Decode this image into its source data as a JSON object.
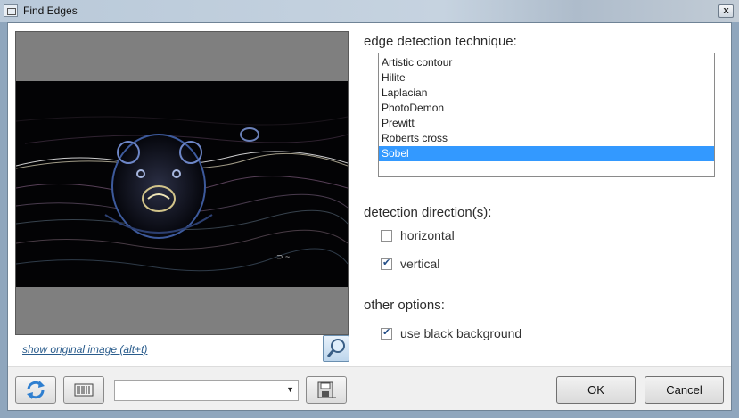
{
  "window": {
    "title": "Find Edges",
    "close_label": "x"
  },
  "preview": {
    "show_original_link": "show original image (alt+t)"
  },
  "technique": {
    "heading": "edge detection technique:",
    "items": [
      {
        "label": "Artistic contour",
        "selected": false
      },
      {
        "label": "Hilite",
        "selected": false
      },
      {
        "label": "Laplacian",
        "selected": false
      },
      {
        "label": "PhotoDemon",
        "selected": false
      },
      {
        "label": "Prewitt",
        "selected": false
      },
      {
        "label": "Roberts cross",
        "selected": false
      },
      {
        "label": "Sobel",
        "selected": true
      }
    ]
  },
  "direction": {
    "heading": "detection direction(s):",
    "horizontal": {
      "label": "horizontal",
      "checked": false
    },
    "vertical": {
      "label": "vertical",
      "checked": true
    }
  },
  "other": {
    "heading": "other options:",
    "black_bg": {
      "label": "use black background",
      "checked": true
    }
  },
  "footer": {
    "preset_value": "",
    "ok_label": "OK",
    "cancel_label": "Cancel"
  },
  "icons": {
    "reset": "refresh-icon",
    "randomize": "barcode-icon",
    "save_preset": "save-disk-icon",
    "zoom": "magnifier-icon"
  },
  "colors": {
    "selection": "#3399ff",
    "link": "#2a5c8c"
  }
}
